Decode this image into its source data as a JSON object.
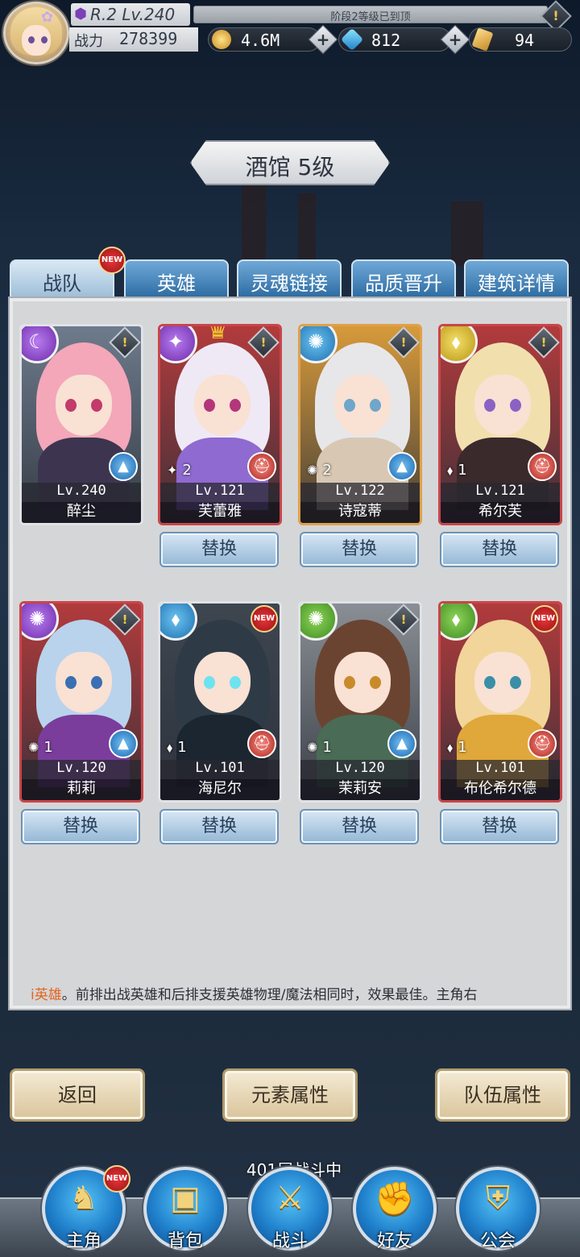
{
  "player": {
    "rank_level": "R.2 Lv.240",
    "exp_text": "阶段2等级已到顶",
    "power_label": "战力",
    "power_value": "278399"
  },
  "resources": {
    "gold": "4.6M",
    "gems": "812",
    "tickets": "94"
  },
  "title": "酒馆 5级",
  "tabs": [
    {
      "label": "战队",
      "active": true,
      "new": true
    },
    {
      "label": "英雄"
    },
    {
      "label": "灵魂链接"
    },
    {
      "label": "品质晋升"
    },
    {
      "label": "建筑详情"
    }
  ],
  "new_badge_text": "NEW",
  "heroes": [
    {
      "level": "Lv.240",
      "name": "醉尘",
      "stars": "",
      "element": "moon",
      "class": "mage",
      "hair": "#f3a7b9",
      "eye": "#c23b6b",
      "bg": "#6d7b8c",
      "body": "#3d3550"
    },
    {
      "level": "Lv.121",
      "name": "芙蕾雅",
      "stars": "2",
      "element": "wing",
      "class": "warrior",
      "hair": "#efe9f6",
      "eye": "#b3367a",
      "bg": "#b23b3c",
      "body": "#8f6ad0",
      "crown": true
    },
    {
      "level": "Lv.122",
      "name": "诗寇蒂",
      "stars": "2",
      "element": "wind",
      "class": "mage",
      "hair": "#e7e7ea",
      "eye": "#6fa6c9",
      "bg": "#d79a3a",
      "body": "#d8c8b3"
    },
    {
      "level": "Lv.121",
      "name": "希尔芙",
      "stars": "1",
      "element": "flame",
      "class": "warrior",
      "hair": "#f1e0ae",
      "eye": "#8a62c4",
      "bg": "#b23b3c",
      "body": "#3a2a2c"
    },
    {
      "level": "Lv.120",
      "name": "莉莉",
      "stars": "1",
      "element": "wind",
      "class": "mage",
      "hair": "#b9d3ec",
      "eye": "#3a6fb3",
      "bg": "#b23b3c",
      "body": "#7a3d9c"
    },
    {
      "level": "Lv.101",
      "name": "海尼尔",
      "stars": "1",
      "element": "flame",
      "class": "warrior",
      "hair": "#2e3b46",
      "eye": "#6ee3f0",
      "bg": "#3e4650",
      "body": "#1c2630",
      "new": true
    },
    {
      "level": "Lv.120",
      "name": "茉莉安",
      "stars": "1",
      "element": "wind",
      "class": "mage",
      "hair": "#6b4431",
      "eye": "#c98a2a",
      "bg": "#8a8f95",
      "body": "#4a6b55"
    },
    {
      "level": "Lv.101",
      "name": "布伦希尔德",
      "stars": "1",
      "element": "flame",
      "class": "warrior",
      "hair": "#f2d59a",
      "eye": "#3a8fa6",
      "bg": "#b23b3c",
      "body": "#e0a83a",
      "new": true
    }
  ],
  "swap_label": "替换",
  "hint": {
    "highlight": "i英雄",
    "text": "。前排出战英雄和后排支援英雄物理/魔法相同时，效果最佳。主角右"
  },
  "actions": {
    "back": "返回",
    "element_attr": "元素属性",
    "team_attr": "队伍属性"
  },
  "battle_status": "401层战斗中",
  "nav": [
    {
      "label": "主角",
      "new": true
    },
    {
      "label": "背包"
    },
    {
      "label": "战斗"
    },
    {
      "label": "好友"
    },
    {
      "label": "公会"
    }
  ]
}
